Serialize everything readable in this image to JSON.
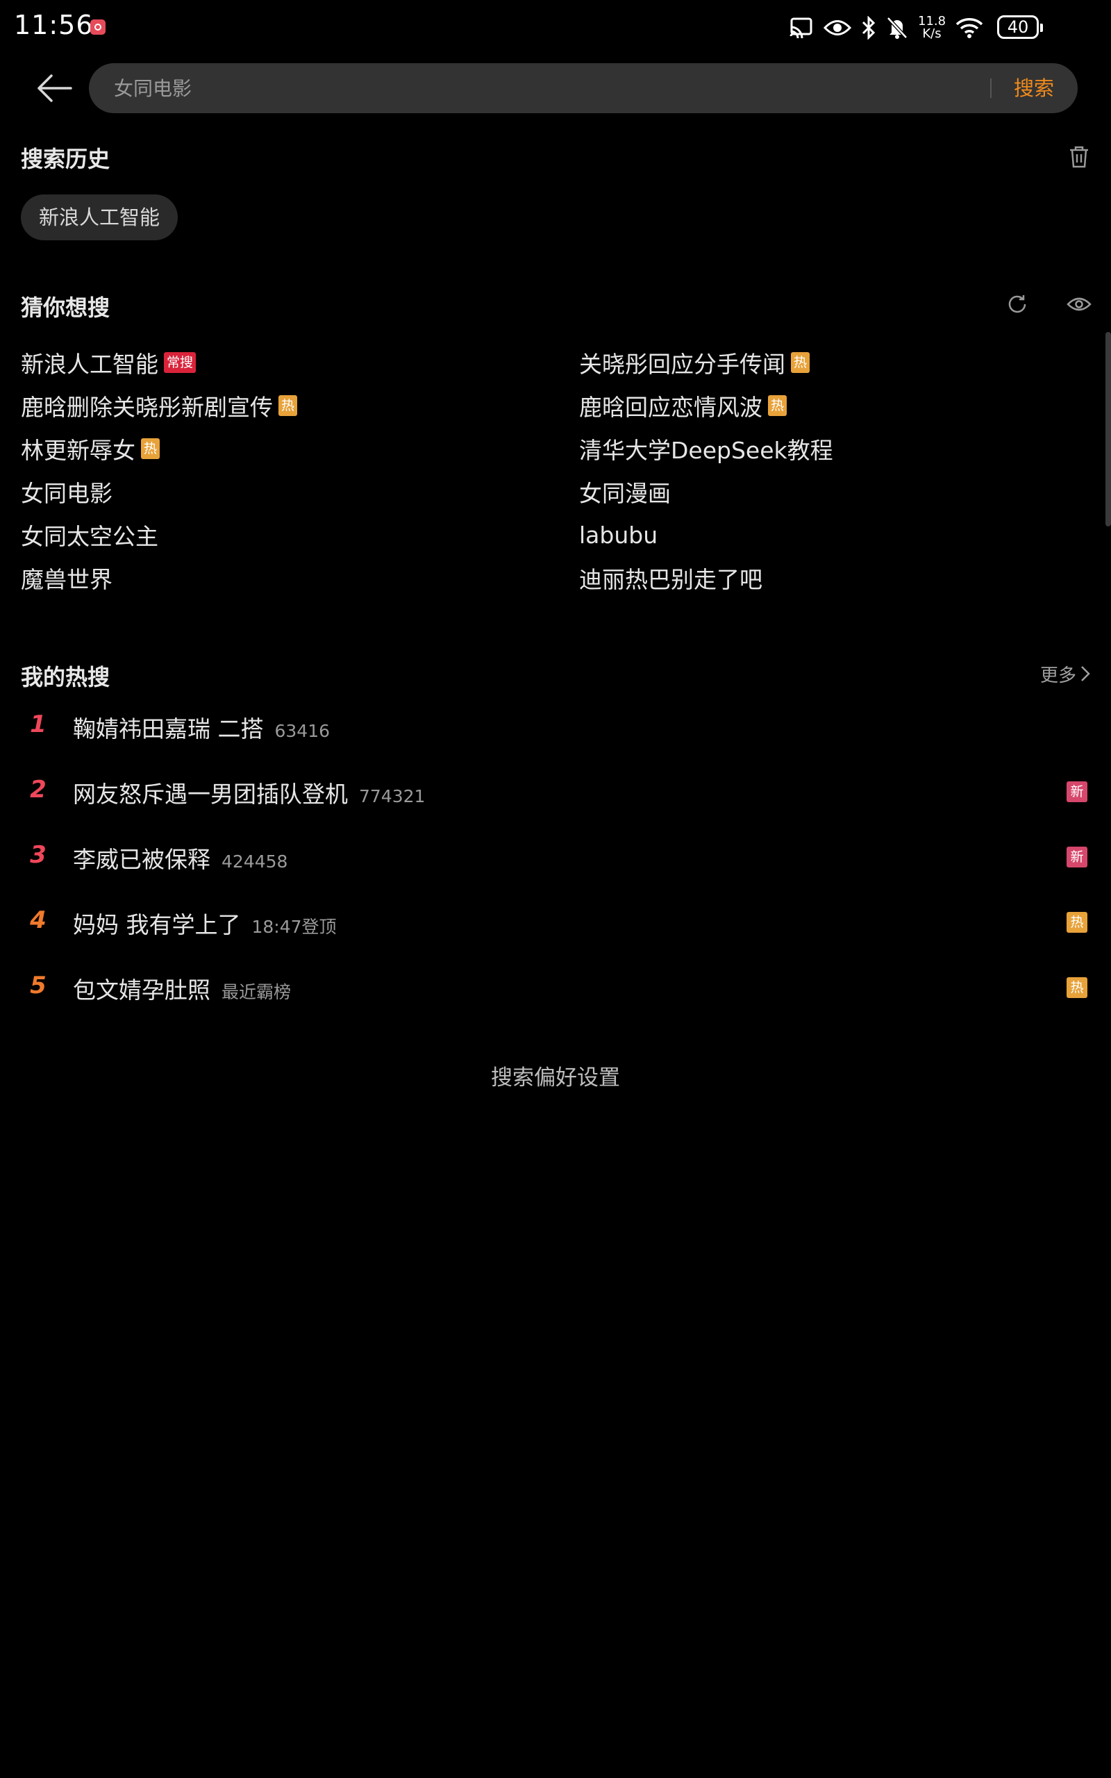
{
  "status_bar": {
    "time": "11:56",
    "net_speed_value": "11.8",
    "net_speed_unit": "K/s",
    "battery": "40"
  },
  "search": {
    "placeholder": "女同电影",
    "submit_label": "搜索"
  },
  "history": {
    "title": "搜索历史",
    "items": [
      "新浪人工智能"
    ]
  },
  "guess": {
    "title": "猜你想搜",
    "left": [
      {
        "text": "新浪人工智能",
        "tag": "常搜",
        "tag_type": "regular"
      },
      {
        "text": "鹿晗删除关晓彤新剧宣传",
        "tag": "热",
        "tag_type": "hot"
      },
      {
        "text": "林更新辱女",
        "tag": "热",
        "tag_type": "hot"
      },
      {
        "text": "女同电影",
        "tag": "",
        "tag_type": ""
      },
      {
        "text": "女同太空公主",
        "tag": "",
        "tag_type": ""
      },
      {
        "text": "魔兽世界",
        "tag": "",
        "tag_type": ""
      }
    ],
    "right": [
      {
        "text": "关晓彤回应分手传闻",
        "tag": "热",
        "tag_type": "hot"
      },
      {
        "text": "鹿晗回应恋情风波",
        "tag": "热",
        "tag_type": "hot"
      },
      {
        "text": "清华大学DeepSeek教程",
        "tag": "",
        "tag_type": ""
      },
      {
        "text": "女同漫画",
        "tag": "",
        "tag_type": ""
      },
      {
        "text": "labubu",
        "tag": "",
        "tag_type": ""
      },
      {
        "text": "迪丽热巴别走了吧",
        "tag": "",
        "tag_type": ""
      }
    ]
  },
  "hot": {
    "title": "我的热搜",
    "more_label": "更多",
    "items": [
      {
        "rank": "1",
        "title": "鞠婧祎田嘉瑞 二搭",
        "meta": "63416",
        "tag": "",
        "tag_type": ""
      },
      {
        "rank": "2",
        "title": "网友怒斥遇一男团插队登机",
        "meta": "774321",
        "tag": "新",
        "tag_type": "new"
      },
      {
        "rank": "3",
        "title": "李威已被保释",
        "meta": "424458",
        "tag": "新",
        "tag_type": "new"
      },
      {
        "rank": "4",
        "title": "妈妈 我有学上了",
        "meta": "18:47登顶",
        "tag": "热",
        "tag_type": "hot"
      },
      {
        "rank": "5",
        "title": "包文婧孕肚照",
        "meta": "最近霸榜",
        "tag": "热",
        "tag_type": "hot"
      }
    ]
  },
  "footer": {
    "pref_label": "搜索偏好设置"
  },
  "colors": {
    "accent": "#f08a1c",
    "rank_top": "#f0475a",
    "rank_other": "#f07a2c",
    "tag_hot": "#e8a23a",
    "tag_regular": "#d9233a",
    "tag_new": "#d6476b"
  }
}
